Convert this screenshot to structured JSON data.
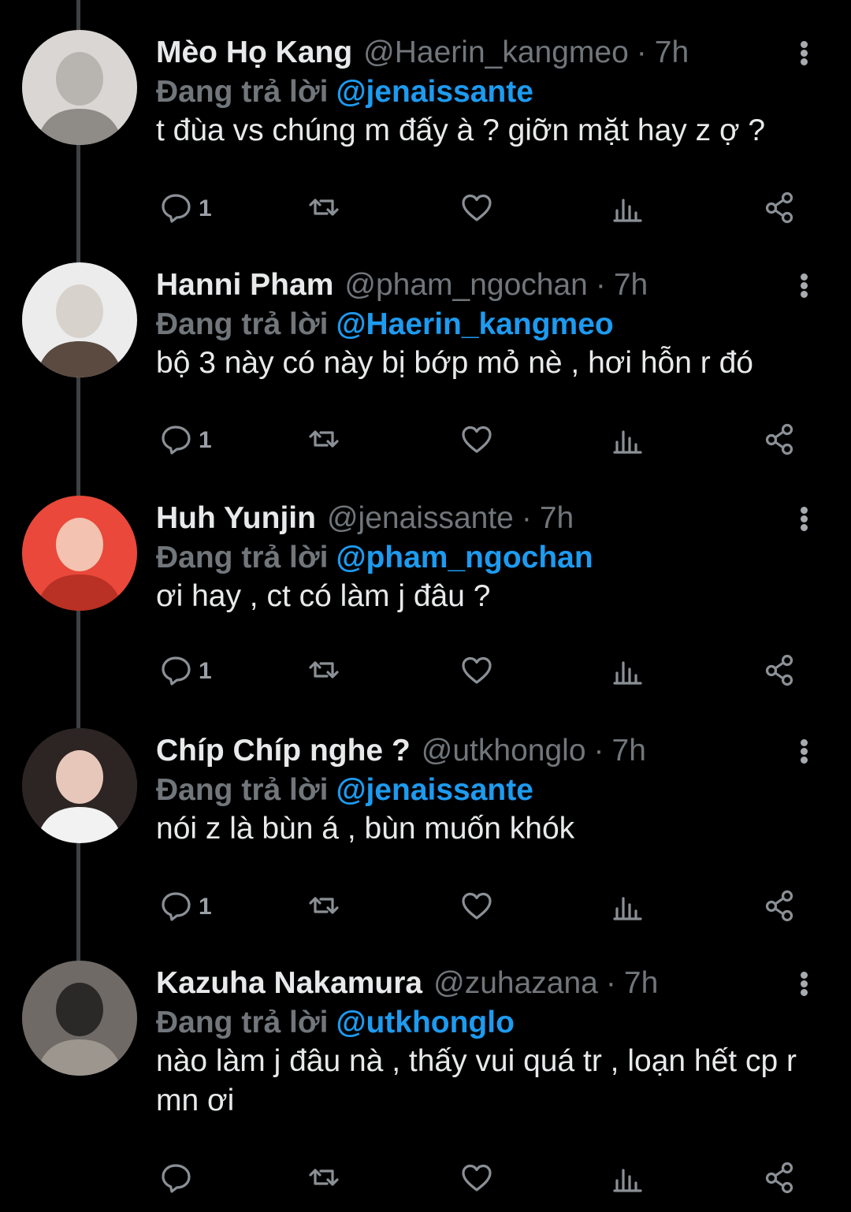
{
  "replying_label": "Đang trả lời",
  "tweets": [
    {
      "name": "Mèo Họ Kang",
      "handle": "@Haerin_kangmeo",
      "time": "7h",
      "reply_to": "@jenaissante",
      "text": "t đùa vs chúng m đấy à ? giỡn mặt hay z ợ ?",
      "reply_count": "1",
      "avatar_colors": [
        "#d9d6d3",
        "#b8b4b0",
        "#8f8b87"
      ]
    },
    {
      "name": "Hanni Pham",
      "handle": "@pham_ngochan",
      "time": "7h",
      "reply_to": "@Haerin_kangmeo",
      "text": "bộ 3 này có này bị bớp mỏ nè , hơi hỗn r đó",
      "reply_count": "1",
      "avatar_colors": [
        "#ececec",
        "#d8d2cc",
        "#5a4a40"
      ]
    },
    {
      "name": "Huh Yunjin",
      "handle": "@jenaissante",
      "time": "7h",
      "reply_to": "@pham_ngochan",
      "text": "ơi hay , ct có làm j đâu ?",
      "reply_count": "1",
      "avatar_colors": [
        "#e9483a",
        "#f3c2b0",
        "#b93024"
      ]
    },
    {
      "name": "Chíp Chíp nghe ?",
      "handle": "@utkhonglo",
      "time": "7h",
      "reply_to": "@jenaissante",
      "text": "nói z là bùn á , bùn muốn khók",
      "reply_count": "1",
      "avatar_colors": [
        "#2c2523",
        "#e8c7bb",
        "#f2f2f2"
      ]
    },
    {
      "name": "Kazuha Nakamura",
      "handle": "@zuhazana",
      "time": "7h",
      "reply_to": "@utkhonglo",
      "text": "nào làm j đâu nà , thấy vui quá tr , loạn hết cp r mn ơi",
      "reply_count": "",
      "avatar_colors": [
        "#6f6a66",
        "#2b2928",
        "#9c968f"
      ]
    }
  ]
}
